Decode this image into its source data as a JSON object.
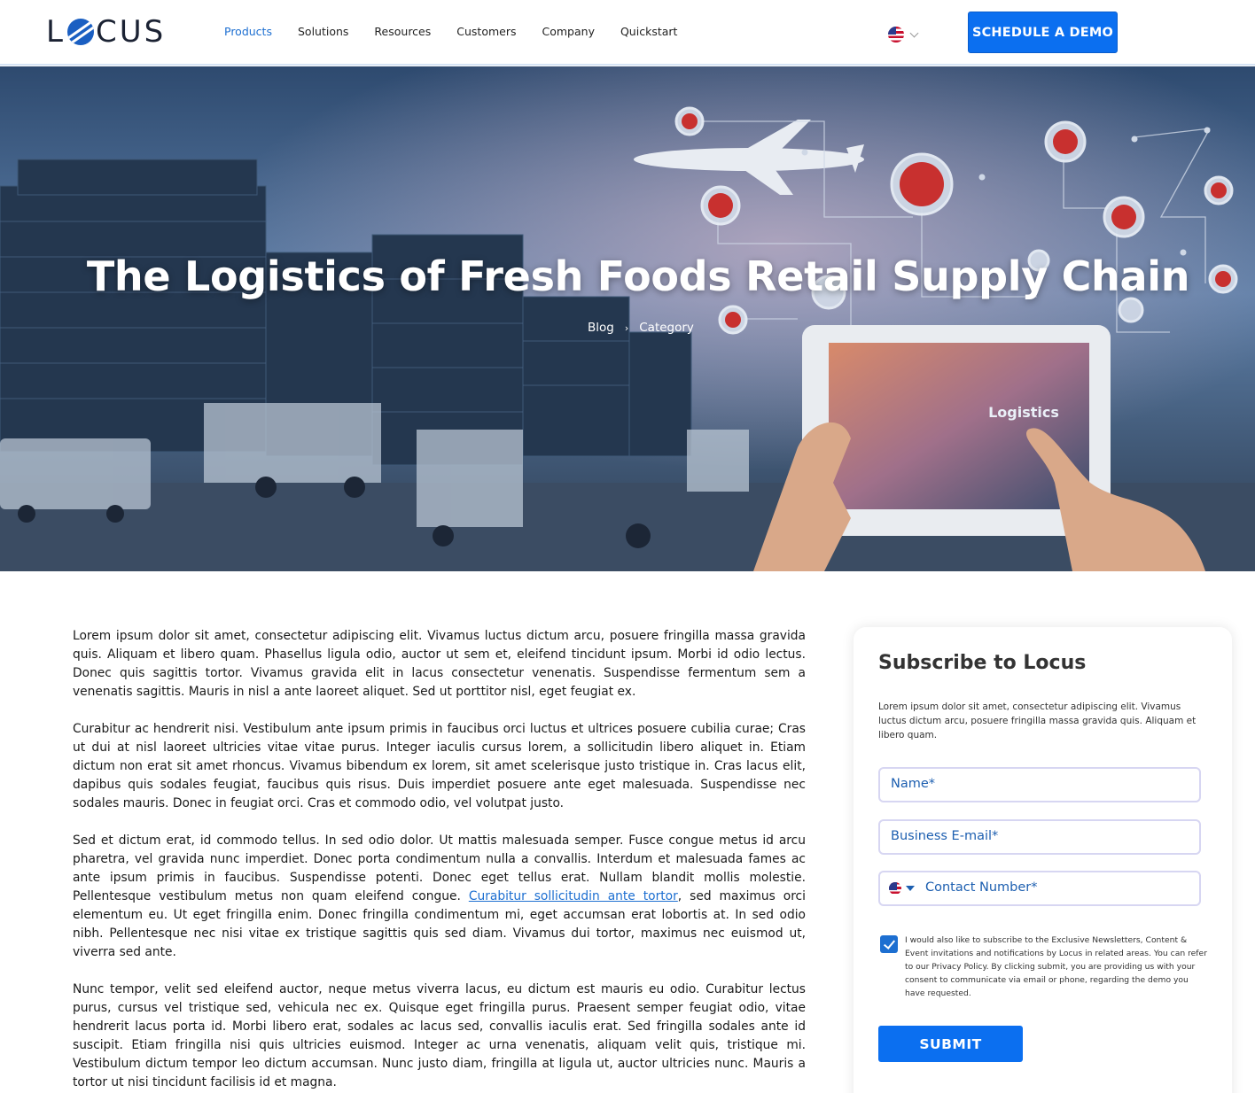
{
  "brand": {
    "logo_text_left": "L",
    "logo_text_right": "CUS",
    "accent": "#0b6ff0",
    "link_color": "#1d6fd1"
  },
  "nav": {
    "items": [
      {
        "label": "Products",
        "active": true
      },
      {
        "label": "Solutions"
      },
      {
        "label": "Resources"
      },
      {
        "label": "Customers"
      },
      {
        "label": "Company"
      },
      {
        "label": "Quickstart"
      }
    ],
    "language_icon": "us-flag-icon",
    "demo_button": "SCHEDULE A DEMO"
  },
  "hero": {
    "title": "The Logistics of Fresh Foods Retail Supply Chain",
    "breadcrumb": [
      "Blog",
      "Category"
    ],
    "tablet_label": "Logistics"
  },
  "article": {
    "p1": "Lorem ipsum dolor sit amet, consectetur adipiscing elit. Vivamus luctus dictum arcu, posuere fringilla massa gravida quis. Aliquam et libero quam. Phasellus ligula odio, auctor ut sem et, eleifend tincidunt ipsum. Morbi id odio lectus. Donec quis sagittis tortor. Vivamus gravida elit in lacus consectetur venenatis. Suspendisse fermentum sem a venenatis sagittis. Mauris in nisl a ante laoreet aliquet. Sed ut porttitor nisl, eget feugiat ex.",
    "p2": "Curabitur ac hendrerit nisi. Vestibulum ante ipsum primis in faucibus orci luctus et ultrices posuere cubilia curae; Cras ut dui at nisl laoreet ultricies vitae vitae purus. Integer iaculis cursus lorem, a sollicitudin libero aliquet in. Etiam dictum non erat sit amet rhoncus. Vivamus bibendum ex lorem, sit amet scelerisque justo tristique in. Cras lacus elit, dapibus quis sodales feugiat, faucibus quis risus. Duis imperdiet posuere ante eget malesuada. Suspendisse nec sodales mauris. Donec in feugiat orci. Cras et commodo odio, vel volutpat justo.",
    "p3_before": "Sed et dictum erat, id commodo tellus. In sed odio dolor. Ut mattis malesuada semper. Fusce congue metus id arcu pharetra, vel gravida nunc imperdiet. Donec porta condimentum nulla a convallis. Interdum et malesuada fames ac ante ipsum primis in faucibus. Suspendisse potenti. Donec eget tellus erat. Nullam blandit mollis molestie. Pellentesque vestibulum metus non quam eleifend congue. ",
    "p3_link": "Curabitur sollicitudin ante tortor",
    "p3_after": ", sed maximus orci elementum eu. Ut eget fringilla enim. Donec fringilla condimentum mi, eget accumsan erat lobortis at. In sed odio nibh. Pellentesque nec nisi vitae ex tristique sagittis quis sed diam. Vivamus dui tortor, maximus nec euismod ut, viverra sed ante.",
    "p4": "Nunc tempor, velit sed eleifend auctor, neque metus viverra lacus, eu dictum est mauris eu odio. Curabitur lectus purus, cursus vel tristique sed, vehicula nec ex. Quisque eget fringilla purus. Praesent semper feugiat odio, vitae hendrerit lacus porta id. Morbi libero erat, sodales ac lacus sed, convallis iaculis erat. Sed fringilla sodales ante id suscipit. Etiam fringilla nisi quis ultricies euismod. Integer ac urna venenatis, aliquam velit quis, tristique mi. Vestibulum dictum tempor leo dictum accumsan. Nunc justo diam, fringilla at ligula ut, auctor ultricies nunc. Mauris a tortor ut nisi tincidunt facilisis id et magna."
  },
  "subscribe": {
    "title": "Subscribe to Locus",
    "description": "Lorem ipsum dolor sit amet, consectetur adipiscing elit. Vivamus luctus dictum arcu, posuere fringilla massa gravida quis. Aliquam et libero quam.",
    "name_placeholder": "Name*",
    "email_placeholder": "Business E-mail*",
    "phone_placeholder": "Contact Number*",
    "consent_checked": true,
    "consent_text": "I would also like to subscribe to the Exclusive Newsletters, Content & Event invitations and notifications by Locus in related areas. You can refer to our Privacy Policy. By clicking submit, you are providing us with your consent to communicate via email or phone, regarding the demo you have requested.",
    "submit_label": "SUBMIT"
  }
}
